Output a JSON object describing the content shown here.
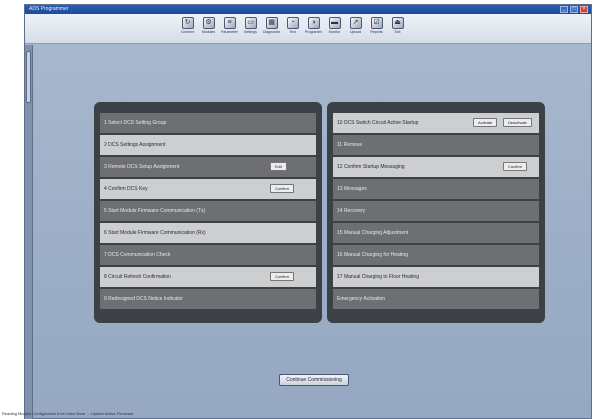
{
  "window": {
    "title": "ADS Programmer",
    "controls": [
      "_",
      "□",
      "×"
    ]
  },
  "toolbar": {
    "items": [
      {
        "label": "Connect",
        "icon": "↻"
      },
      {
        "label": "Modules",
        "icon": "⚙"
      },
      {
        "label": "Parameters",
        "icon": "≡"
      },
      {
        "label": "Settings",
        "icon": "▭"
      },
      {
        "label": "Diagnostics",
        "icon": "▦"
      },
      {
        "label": "Test",
        "icon": "◔"
      },
      {
        "label": "Programming",
        "icon": "◑"
      },
      {
        "label": "Monitor",
        "icon": "▬"
      },
      {
        "label": "Upload",
        "icon": "↗"
      },
      {
        "label": "Reports",
        "icon": "☑"
      },
      {
        "label": "Exit",
        "icon": "⏏"
      }
    ]
  },
  "left_panel": {
    "rows": [
      {
        "label": "1 Select DCS Setting Group",
        "style": "dark"
      },
      {
        "label": "2 DCS Settings Assignment",
        "style": "light"
      },
      {
        "label": "3 Remote DCS Setup Assignment",
        "style": "dark",
        "button": "Edit"
      },
      {
        "label": "4 Confirm DCS Key",
        "style": "light",
        "button": "Confirm"
      },
      {
        "label": "5 Start Module Firmware Communication (Tx)",
        "style": "dark"
      },
      {
        "label": "6 Start Module Firmware Communication (Rx)",
        "style": "light"
      },
      {
        "label": "7 DCS Communication Check",
        "style": "dark"
      },
      {
        "label": "8 Circuit Refresh Confirmation",
        "style": "light",
        "button": "Confirm"
      },
      {
        "label": "9 Redesigned DCS Notice Indicator",
        "style": "dark"
      }
    ]
  },
  "right_panel": {
    "rows": [
      {
        "label": "10 DCS Switch Circuit Active Startup",
        "style": "light",
        "buttons": [
          "Activate",
          "Deactivate"
        ]
      },
      {
        "label": "11 Remove",
        "style": "dark"
      },
      {
        "label": "12 Confirm Startup Messaging",
        "style": "light",
        "button": "Confirm"
      },
      {
        "label": "13 Messages",
        "style": "dark"
      },
      {
        "label": "14 Recovery",
        "style": "dark"
      },
      {
        "label": "15 Manual Charging Adjustment",
        "style": "dark"
      },
      {
        "label": "16 Manual Charging for Heating",
        "style": "dark"
      },
      {
        "label": "17 Manual Charging to Floor Heating",
        "style": "light"
      },
      {
        "label": "Emergency Activation",
        "style": "dark"
      }
    ]
  },
  "footer": {
    "continue_button": "Continue Commissioning",
    "status_text": "Reading Module Configuration from Data Store ... Update Active Firmware"
  }
}
